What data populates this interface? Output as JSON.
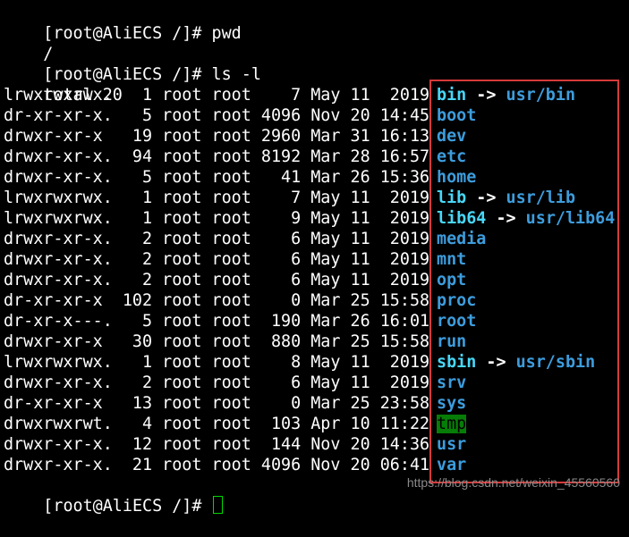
{
  "terminal": {
    "prompt": "[root@AliECS /]# ",
    "cmd_pwd": "pwd",
    "pwd_output": "/",
    "cmd_ls": "ls -l",
    "total_line": "total 20",
    "rows": [
      {
        "meta": "lrwxrwxrwx.   1 root root    7 May 11  2019 ",
        "name": "bin",
        "link_arrow": " -> ",
        "target": "usr/bin"
      },
      {
        "meta": "dr-xr-xr-x.   5 root root 4096 Nov 20 14:45 ",
        "name": "boot"
      },
      {
        "meta": "drwxr-xr-x   19 root root 2960 Mar 31 16:13 ",
        "name": "dev"
      },
      {
        "meta": "drwxr-xr-x.  94 root root 8192 Mar 28 16:57 ",
        "name": "etc"
      },
      {
        "meta": "drwxr-xr-x.   5 root root   41 Mar 26 15:36 ",
        "name": "home"
      },
      {
        "meta": "lrwxrwxrwx.   1 root root    7 May 11  2019 ",
        "name": "lib",
        "link_arrow": " -> ",
        "target": "usr/lib"
      },
      {
        "meta": "lrwxrwxrwx.   1 root root    9 May 11  2019 ",
        "name": "lib64",
        "link_arrow": " -> ",
        "target": "usr/lib64"
      },
      {
        "meta": "drwxr-xr-x.   2 root root    6 May 11  2019 ",
        "name": "media"
      },
      {
        "meta": "drwxr-xr-x.   2 root root    6 May 11  2019 ",
        "name": "mnt"
      },
      {
        "meta": "drwxr-xr-x.   2 root root    6 May 11  2019 ",
        "name": "opt"
      },
      {
        "meta": "dr-xr-xr-x  102 root root    0 Mar 25 15:58 ",
        "name": "proc"
      },
      {
        "meta": "dr-xr-x---.   5 root root  190 Mar 26 16:01 ",
        "name": "root"
      },
      {
        "meta": "drwxr-xr-x   30 root root  880 Mar 25 15:58 ",
        "name": "run"
      },
      {
        "meta": "lrwxrwxrwx.   1 root root    8 May 11  2019 ",
        "name": "sbin",
        "link_arrow": " -> ",
        "target": "usr/sbin"
      },
      {
        "meta": "drwxr-xr-x.   2 root root    6 May 11  2019 ",
        "name": "srv"
      },
      {
        "meta": "dr-xr-xr-x   13 root root    0 Mar 25 23:58 ",
        "name": "sys"
      },
      {
        "meta": "drwxrwxrwt.   4 root root  103 Apr 10 11:22 ",
        "name": "tmp"
      },
      {
        "meta": "drwxr-xr-x.  12 root root  144 Nov 20 14:36 ",
        "name": "usr"
      },
      {
        "meta": "drwxr-xr-x.  21 root root 4096 Nov 20 06:41 ",
        "name": "var"
      }
    ]
  },
  "watermark": "https://blog.csdn.net/weixin_45560560",
  "colors": {
    "background": "#000000",
    "text": "#ffffff",
    "directory": "#3d9ddd",
    "symlink": "#48d7f8",
    "sticky_dir_bg": "#067d06",
    "highlight_border": "#d63a3a",
    "cursor": "#00d800"
  }
}
